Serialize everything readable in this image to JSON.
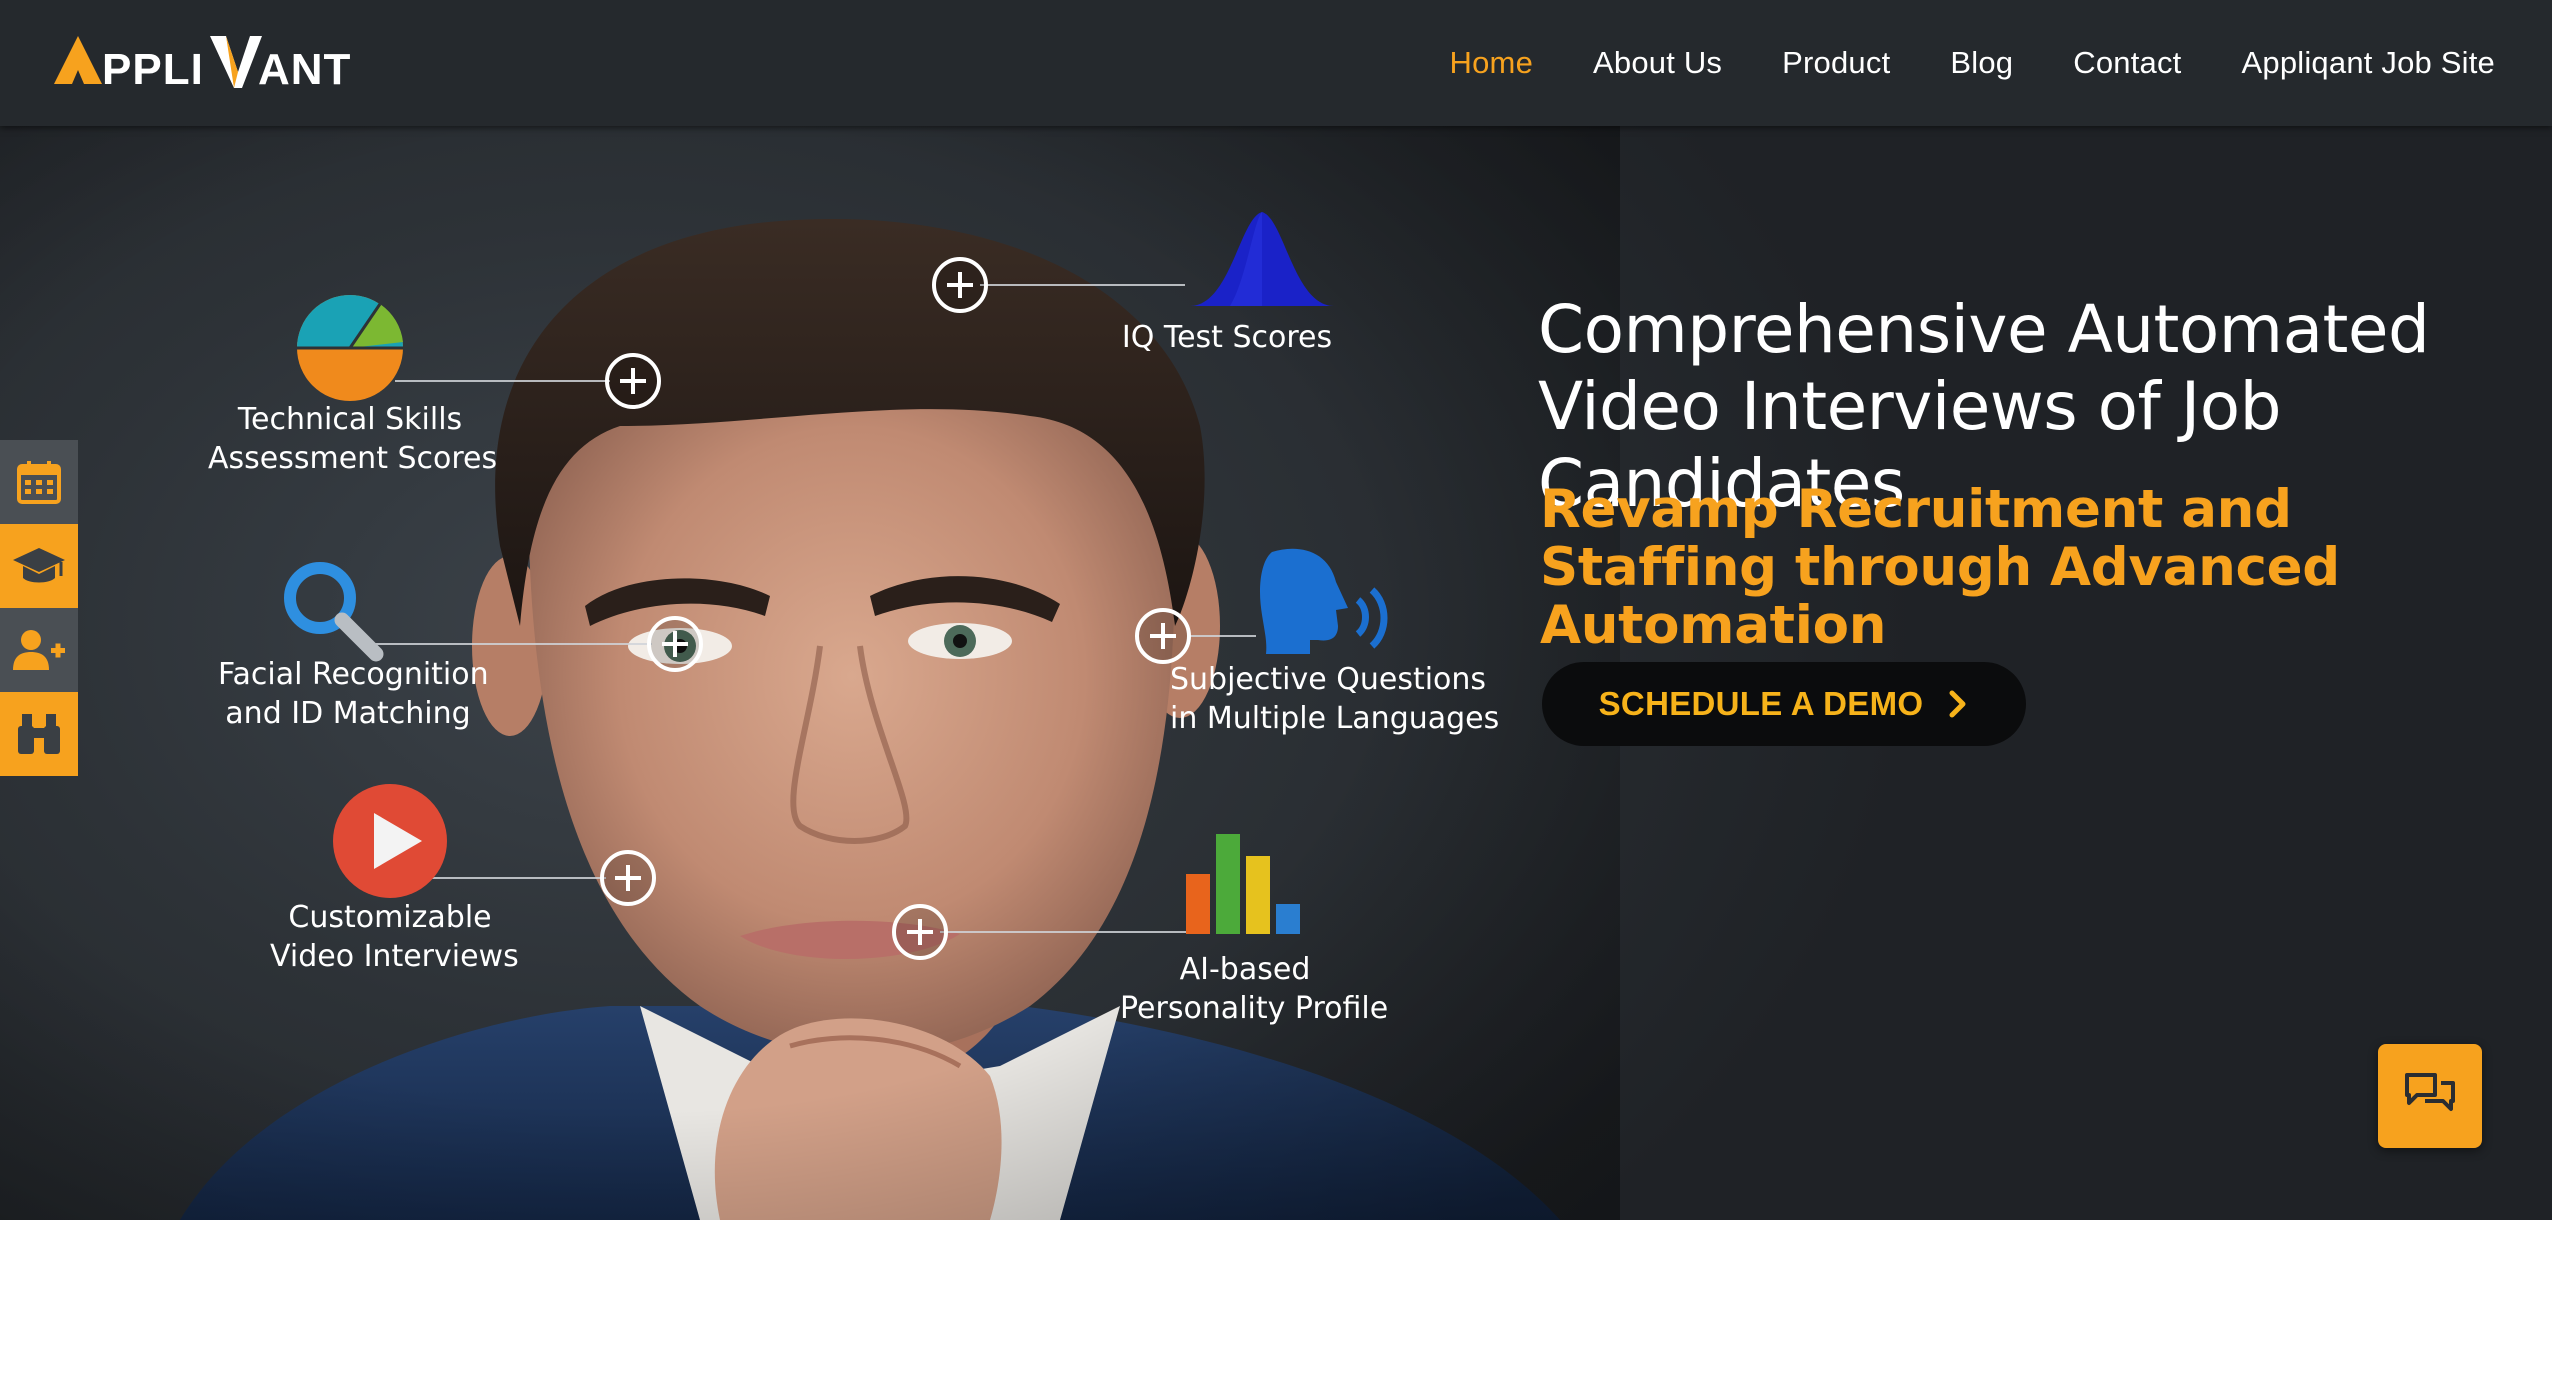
{
  "header": {
    "logo_text": "APPLIQANT",
    "nav": [
      {
        "label": "Home",
        "active": true
      },
      {
        "label": "About Us",
        "active": false
      },
      {
        "label": "Product",
        "active": false
      },
      {
        "label": "Blog",
        "active": false
      },
      {
        "label": "Contact",
        "active": false
      },
      {
        "label": "Appliqant Job Site",
        "active": false
      }
    ]
  },
  "hero": {
    "headline": "Comprehensive Automated Video Interviews of Job Candidates",
    "subheadline": "Revamp Recruitment and Staffing through Advanced Automation",
    "cta_label": "SCHEDULE A DEMO",
    "features": [
      {
        "line1": "Technical Skills",
        "line2": "Assessment Scores",
        "icon": "pie-chart-icon"
      },
      {
        "line1": "IQ Test Scores",
        "line2": "",
        "icon": "bell-curve-icon"
      },
      {
        "line1": "Facial Recognition",
        "line2": "and ID Matching",
        "icon": "magnifier-icon"
      },
      {
        "line1": "Subjective Questions",
        "line2": "in Multiple Languages",
        "icon": "speaking-head-icon"
      },
      {
        "line1": "Customizable",
        "line2": "Video Interviews",
        "icon": "play-icon"
      },
      {
        "line1": "AI-based",
        "line2": "Personality Profile",
        "icon": "bar-chart-icon"
      }
    ]
  },
  "side_tabs": [
    {
      "icon": "calendar-icon"
    },
    {
      "icon": "graduation-cap-icon"
    },
    {
      "icon": "add-user-icon"
    },
    {
      "icon": "binoculars-icon"
    }
  ],
  "colors": {
    "accent": "#f7a21e",
    "header_bg": "#25292d",
    "cta_bg": "#0b0c0d",
    "cta_text": "#f7b31a"
  }
}
